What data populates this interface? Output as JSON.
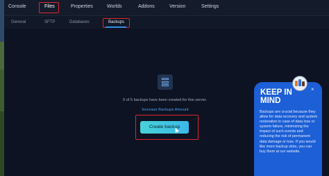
{
  "nav": {
    "tabs": [
      {
        "label": "Console"
      },
      {
        "label": "Files"
      },
      {
        "label": "Properties"
      },
      {
        "label": "Worlds"
      },
      {
        "label": "Addons"
      },
      {
        "label": "Version"
      },
      {
        "label": "Settings"
      }
    ],
    "active_index": 1
  },
  "files_nav": {
    "tabs": [
      {
        "label": "General"
      },
      {
        "label": "SFTP"
      },
      {
        "label": "Databases"
      },
      {
        "label": "Backups"
      }
    ],
    "active_index": 3
  },
  "backups": {
    "status_text": "0 of 5 backups have been created for this server.",
    "increase_link": "Increase Backups Amount",
    "create_button": "Create backup"
  },
  "info_panel": {
    "title": "KEEP IN MIND",
    "body": "Backups are crucial because they allow for data recovery and system restoration in case of data loss or system failure, minimizing the impact of such events and reducing the risk of permanent data damage or loss. If you would like more backup slots, you can buy them at our website.",
    "close_glyph": "×"
  },
  "icons": {
    "server": "server-stack-icon",
    "close": "close-icon",
    "cursor": "mouse-pointer-icon"
  },
  "colors": {
    "accent": "#2f8fe8",
    "highlight": "#e0262e",
    "button": "#48d2d8",
    "panel": "#1c5fd6"
  }
}
